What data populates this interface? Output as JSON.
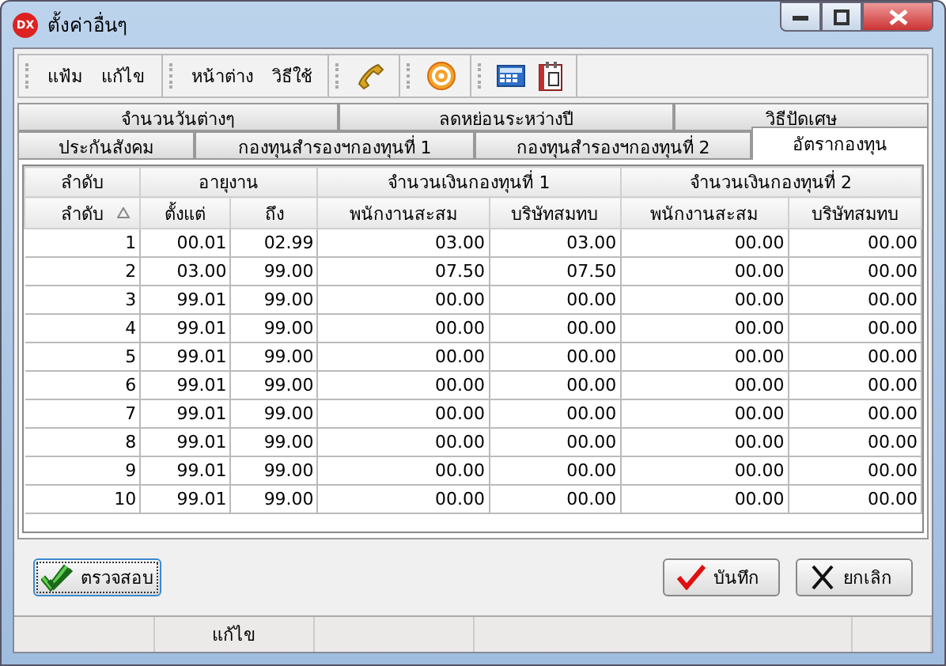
{
  "window": {
    "title": "ตั้งค่าอื่นๆ",
    "app_badge": "DX"
  },
  "menu": [
    "แฟ้ม",
    "แก้ไข",
    "หน้าต่าง",
    "วิธีใช้"
  ],
  "tab_rows": [
    [
      {
        "label": "จำนวนวันต่างๆ",
        "selected": false
      },
      {
        "label": "ลดหย่อนระหว่างปี",
        "selected": false
      },
      {
        "label": "วิธีปัดเศษ",
        "selected": false
      }
    ],
    [
      {
        "label": "ประกันสังคม",
        "selected": false
      },
      {
        "label": "กองทุนสำรองฯกองทุนที่ 1",
        "selected": false
      },
      {
        "label": "กองทุนสำรองฯกองทุนที่ 2",
        "selected": false
      },
      {
        "label": "อัตรากองทุน",
        "selected": true
      }
    ]
  ],
  "table": {
    "groups": [
      {
        "label": "ลำดับ"
      },
      {
        "label": "อายุงาน"
      },
      {
        "label": "จำนวนเงินกองทุนที่ 1"
      },
      {
        "label": "จำนวนเงินกองทุนที่ 2"
      }
    ],
    "columns": [
      {
        "label": "ลำดับ",
        "sorted": true
      },
      {
        "label": "ตั้งแต่",
        "sorted": false
      },
      {
        "label": "ถึง",
        "sorted": false
      },
      {
        "label": "พนักงานสะสม",
        "sorted": false
      },
      {
        "label": "บริษัทสมทบ",
        "sorted": false
      },
      {
        "label": "พนักงานสะสม",
        "sorted": false
      },
      {
        "label": "บริษัทสมทบ",
        "sorted": false
      }
    ],
    "rows": [
      [
        "1",
        "00.01",
        "02.99",
        "03.00",
        "03.00",
        "00.00",
        "00.00"
      ],
      [
        "2",
        "03.00",
        "99.00",
        "07.50",
        "07.50",
        "00.00",
        "00.00"
      ],
      [
        "3",
        "99.01",
        "99.00",
        "00.00",
        "00.00",
        "00.00",
        "00.00"
      ],
      [
        "4",
        "99.01",
        "99.00",
        "00.00",
        "00.00",
        "00.00",
        "00.00"
      ],
      [
        "5",
        "99.01",
        "99.00",
        "00.00",
        "00.00",
        "00.00",
        "00.00"
      ],
      [
        "6",
        "99.01",
        "99.00",
        "00.00",
        "00.00",
        "00.00",
        "00.00"
      ],
      [
        "7",
        "99.01",
        "99.00",
        "00.00",
        "00.00",
        "00.00",
        "00.00"
      ],
      [
        "8",
        "99.01",
        "99.00",
        "00.00",
        "00.00",
        "00.00",
        "00.00"
      ],
      [
        "9",
        "99.01",
        "99.00",
        "00.00",
        "00.00",
        "00.00",
        "00.00"
      ],
      [
        "10",
        "99.01",
        "99.00",
        "00.00",
        "00.00",
        "00.00",
        "00.00"
      ]
    ]
  },
  "buttons": {
    "check": "ตรวจสอบ",
    "save": "บันทึก",
    "cancel": "ยกเลิก"
  },
  "status_bar": {
    "mode": "แก้ไข"
  }
}
